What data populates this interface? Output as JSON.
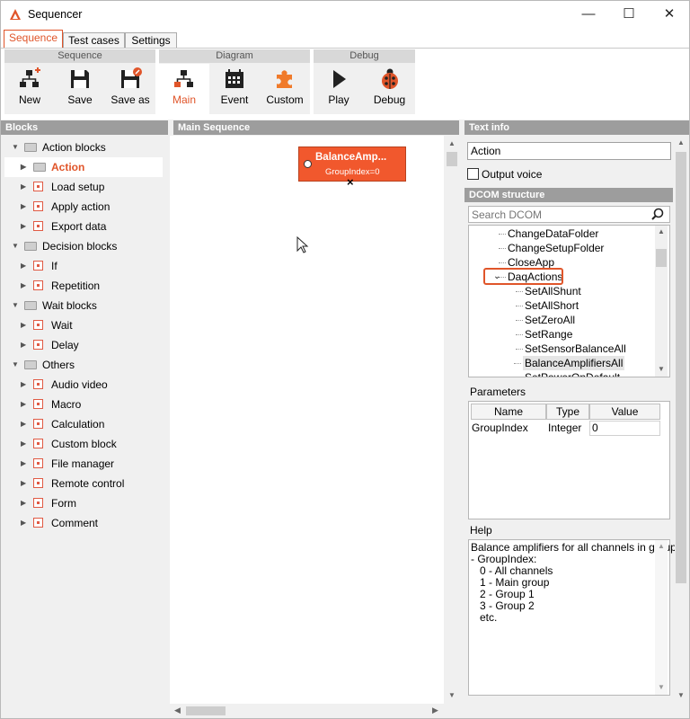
{
  "window": {
    "title": "Sequencer",
    "minimize": "—",
    "maximize": "☐",
    "close": "✕"
  },
  "tabs": [
    "Sequence",
    "Test cases",
    "Settings"
  ],
  "ribbon": {
    "groups": [
      "Sequence",
      "Diagram",
      "Debug"
    ],
    "buttons": [
      {
        "label": "New",
        "icon": "new-icon"
      },
      {
        "label": "Save",
        "icon": "save-icon"
      },
      {
        "label": "Save as",
        "icon": "save-as-icon"
      },
      {
        "label": "Main",
        "icon": "main-diagram-icon",
        "selected": true
      },
      {
        "label": "Event",
        "icon": "calendar-icon"
      },
      {
        "label": "Custom",
        "icon": "puzzle-icon"
      },
      {
        "label": "Play",
        "icon": "play-icon"
      },
      {
        "label": "Debug",
        "icon": "ladybug-icon"
      }
    ]
  },
  "blocks": {
    "header": "Blocks",
    "tree": [
      {
        "label": "Action blocks",
        "type": "folder",
        "level": 0
      },
      {
        "label": "Action",
        "type": "folder",
        "level": 1,
        "selected": true
      },
      {
        "label": "Load setup",
        "type": "block",
        "level": 1
      },
      {
        "label": "Apply action",
        "type": "block",
        "level": 1
      },
      {
        "label": "Export data",
        "type": "block",
        "level": 1
      },
      {
        "label": "Decision blocks",
        "type": "folder",
        "level": 0
      },
      {
        "label": "If",
        "type": "block",
        "level": 1
      },
      {
        "label": "Repetition",
        "type": "block",
        "level": 1
      },
      {
        "label": "Wait blocks",
        "type": "folder",
        "level": 0
      },
      {
        "label": "Wait",
        "type": "block",
        "level": 1
      },
      {
        "label": "Delay",
        "type": "block",
        "level": 1
      },
      {
        "label": "Others",
        "type": "folder",
        "level": 0
      },
      {
        "label": "Audio video",
        "type": "block",
        "level": 1
      },
      {
        "label": "Macro",
        "type": "block",
        "level": 1
      },
      {
        "label": "Calculation",
        "type": "block",
        "level": 1
      },
      {
        "label": "Custom block",
        "type": "block",
        "level": 1
      },
      {
        "label": "File manager",
        "type": "block",
        "level": 1
      },
      {
        "label": "Remote control",
        "type": "block",
        "level": 1
      },
      {
        "label": "Form",
        "type": "block",
        "level": 1
      },
      {
        "label": "Comment",
        "type": "block",
        "level": 1
      }
    ]
  },
  "main": {
    "header": "Main Sequence",
    "node": {
      "title": "BalanceAmp...",
      "subtitle": "GroupIndex=0"
    }
  },
  "textinfo": {
    "header": "Text info",
    "value": "Action",
    "output_voice": "Output voice",
    "dcom_header": "DCOM structure",
    "search_placeholder": "Search DCOM",
    "dcom_items": [
      {
        "label": "ChangeDataFolder",
        "level": 0
      },
      {
        "label": "ChangeSetupFolder",
        "level": 0
      },
      {
        "label": "CloseApp",
        "level": 0
      },
      {
        "label": "DaqActions",
        "level": 0,
        "expanded": true,
        "highlighted": true
      },
      {
        "label": "SetAllShunt",
        "level": 1
      },
      {
        "label": "SetAllShort",
        "level": 1
      },
      {
        "label": "SetZeroAll",
        "level": 1
      },
      {
        "label": "SetRange",
        "level": 1
      },
      {
        "label": "SetSensorBalanceAll",
        "level": 1
      },
      {
        "label": "BalanceAmplifiersAll",
        "level": 1,
        "selected": true
      },
      {
        "label": "SetPowerOnDefault",
        "level": 1
      }
    ],
    "parameters_label": "Parameters",
    "param_columns": [
      "Name",
      "Type",
      "Value"
    ],
    "params": [
      {
        "name": "GroupIndex",
        "type": "Integer",
        "value": "0"
      }
    ],
    "help_label": "Help",
    "help_lines": [
      "Balance amplifiers for all channels in group",
      "- GroupIndex:",
      "   0 - All channels",
      "   1 - Main group",
      "   2 - Group 1",
      "   3 - Group 2",
      "   etc."
    ]
  },
  "colors": {
    "accent": "#e0552a",
    "node": "#f1582d",
    "header": "#9d9d9d"
  }
}
